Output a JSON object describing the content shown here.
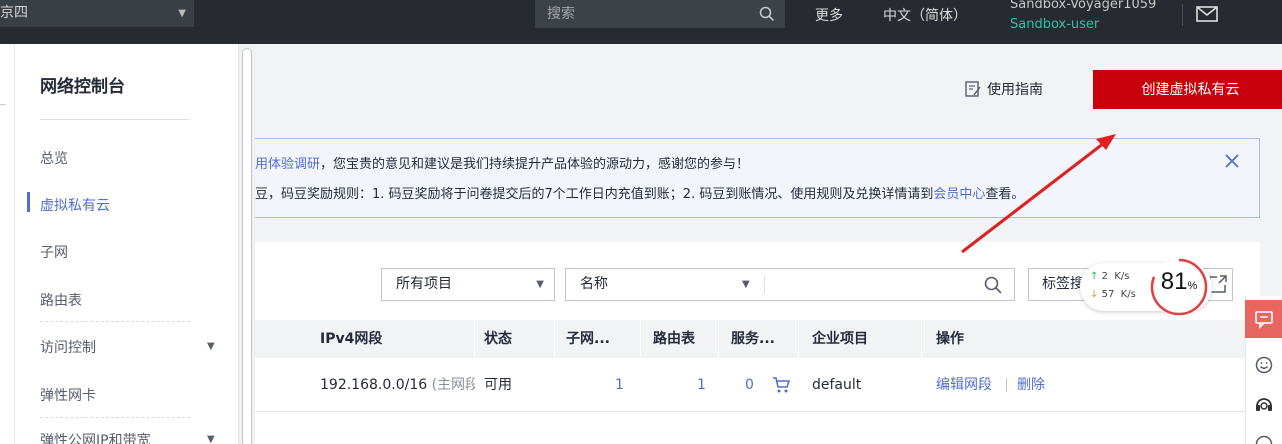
{
  "topbar": {
    "region": "京四",
    "search_placeholder": "搜索",
    "more": "更多",
    "language": "中文（简体）",
    "username": "Sandbox-Voyager1059",
    "subuser": "Sandbox-user"
  },
  "sidebar": {
    "title": "网络控制台",
    "items": [
      "总览",
      "虚拟私有云",
      "子网",
      "路由表",
      "访问控制",
      "弹性网卡",
      "弹性公网IP和带宽"
    ]
  },
  "main": {
    "guide": "使用指南",
    "create_button": "创建虚拟私有云",
    "notice_line1_link": "用体验调研",
    "notice_line1_text": "，您宝贵的意见和建议是我们持续提升产品体验的源动力，感谢您的参与！",
    "notice_line2_pre": "豆，码豆奖励规则：1. 码豆奖励将于问卷提交后的7个工作日内充值到账；2. 码豆到账情况、使用规则及兑换详情请到",
    "notice_line2_link": "会员中心",
    "notice_line2_post": "查看。"
  },
  "filters": {
    "project": "所有项目",
    "name_field": "名称",
    "tag": "标签搜"
  },
  "table": {
    "headers": [
      "IPv4网段",
      "状态",
      "子网...",
      "路由表",
      "服务...",
      "企业项目",
      "操作"
    ],
    "row": {
      "cidr": "192.168.0.0/16",
      "cidr_note": "(主网段",
      "status": "可用",
      "subnets": "1",
      "route_tables": "1",
      "services": "0",
      "enterprise_project": "default",
      "edit": "编辑网段",
      "delete": "删除"
    }
  },
  "speed_widget": {
    "upload": "2",
    "upload_unit": "K/s",
    "download": "57",
    "download_unit": "K/s",
    "percent": "81",
    "percent_sign": "%",
    "percent_value": 0.81
  },
  "colors": {
    "accent": "#526ecc",
    "primary_button": "#c7000b",
    "topbar": "#272a30",
    "annotation_arrow": "#e02020"
  },
  "icons": [
    "search-icon",
    "mail-icon",
    "guide-icon",
    "close-icon",
    "cart-icon",
    "expand-icon",
    "feedback-icon",
    "smile-icon",
    "headset-icon"
  ]
}
